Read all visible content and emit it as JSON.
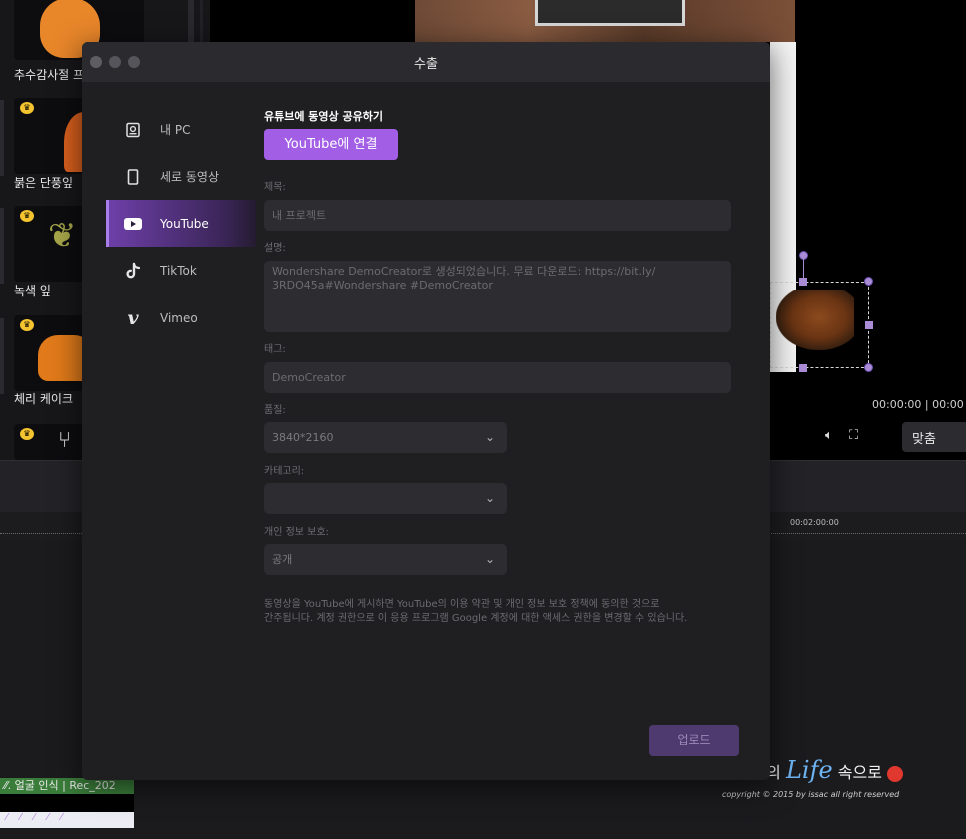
{
  "background": {
    "stickers": [
      {
        "label": "추수감사절 프",
        "color": "#e8862a"
      },
      {
        "label": "붉은 단풍잎",
        "color": "#d9601e"
      },
      {
        "label": "녹색 잎",
        "color": "#a7a64a"
      },
      {
        "label": "체리 케이크",
        "color": "#e07a1a"
      },
      {
        "label": "",
        "color": "#d0d0d0"
      }
    ],
    "preview": {
      "time": "00:00:00  |  00:00",
      "volume_icon": "speaker-icon",
      "fullscreen_icon": "fullscreen-icon",
      "fit_label": "맞춤"
    },
    "ruler_timecode": "00:02:00:00",
    "clip_label": "⁄⁄. 얼굴 인식  |  Rec_202",
    "clip_markers": "⁄⁄⁄⁄⁄"
  },
  "dialog": {
    "title": "수출",
    "nav": [
      {
        "label": "내 PC",
        "icon": "hard-drive-icon"
      },
      {
        "label": "세로 동영상",
        "icon": "phone-icon"
      },
      {
        "label": "YouTube",
        "icon": "youtube-icon",
        "active": true
      },
      {
        "label": "TikTok",
        "icon": "tiktok-icon"
      },
      {
        "label": "Vimeo",
        "icon": "vimeo-icon"
      }
    ],
    "form": {
      "section_title": "유튜브에 동영상 공유하기",
      "connect_label": "YouTube에 연결",
      "title_label": "제목:",
      "title_value": "내 프로젝트",
      "desc_label": "설명:",
      "desc_value_line1": "Wondershare DemoCreator로 생성되었습니다. 무료 다운로드: https://bit.ly/",
      "desc_value_line2": "3RDO45a#Wondershare #DemoCreator",
      "tags_label": "태그:",
      "tags_value": "DemoCreator",
      "quality_label": "품질:",
      "quality_value": "3840*2160",
      "category_label": "카테고리:",
      "category_value": "",
      "privacy_label": "개인 정보 보호:",
      "privacy_value": "공개",
      "notice_line1": "동영상을 YouTube에 게시하면 YouTube의 이용 약관 및 개인 정보 보호 정책에 동의한 것으로",
      "notice_line2": "간주됩니다. 계정 권한으로 이 응용 프로그램 Google 계정에 대한 액세스 권한을 변경할 수 있습니다.",
      "upload_label": "업로드"
    }
  },
  "watermark": {
    "prefix": "아이작의 ",
    "life": "Life",
    "suffix": " 속으로 ",
    "copyright": "copyright © 2015 by issac all right reserved"
  }
}
